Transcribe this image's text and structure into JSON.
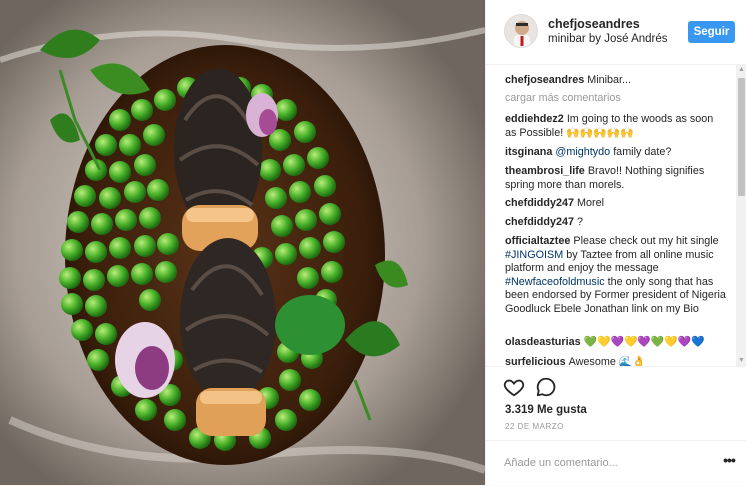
{
  "post": {
    "author": {
      "username": "chefjoseandres",
      "location": "minibar by José Andrés"
    },
    "follow_label": "Seguir",
    "caption": {
      "user": "chefjoseandres",
      "text": "Minibar..."
    },
    "load_more_label": "cargar más comentarios",
    "comments": [
      {
        "user": "eddiehdez2",
        "text": "Im going to the woods as soon as Possible! 🙌🙌🙌🙌🙌"
      },
      {
        "user": "itsginana",
        "mention": "@mightydo",
        "text": "family date?"
      },
      {
        "user": "theambrosi_life",
        "text": "Bravo!! Nothing signifies spring more than morels."
      },
      {
        "user": "chefdiddy247",
        "text": "Morel"
      },
      {
        "user": "chefdiddy247",
        "text": "?"
      },
      {
        "user": "officialtaztee",
        "text_before": "Please check out my hit single",
        "hashtag1": "#JINGOISM",
        "text_mid": "by Taztee from all online music platform and enjoy the message",
        "hashtag2": "#Newfaceofoldmusic",
        "text_after": "the only song that has been endorsed by Former president of Nigeria Goodluck Ebele Jonathan link on my Bio"
      },
      {
        "user": "olasdeasturias",
        "text": "💚💛💜💛💜💚💛💜💙"
      },
      {
        "user": "surfelicious",
        "text": "Awesome 🌊👌"
      }
    ],
    "likes": "3.319 Me gusta",
    "date": "22 de marzo",
    "add_comment_placeholder": "Añade un comentario...",
    "more_options_label": "•••"
  },
  "icons": {
    "like": "heart-icon",
    "comment": "comment-icon",
    "options": "more-options-icon"
  },
  "colors": {
    "accent": "#3897f0",
    "link": "#003569",
    "muted": "#999999"
  }
}
